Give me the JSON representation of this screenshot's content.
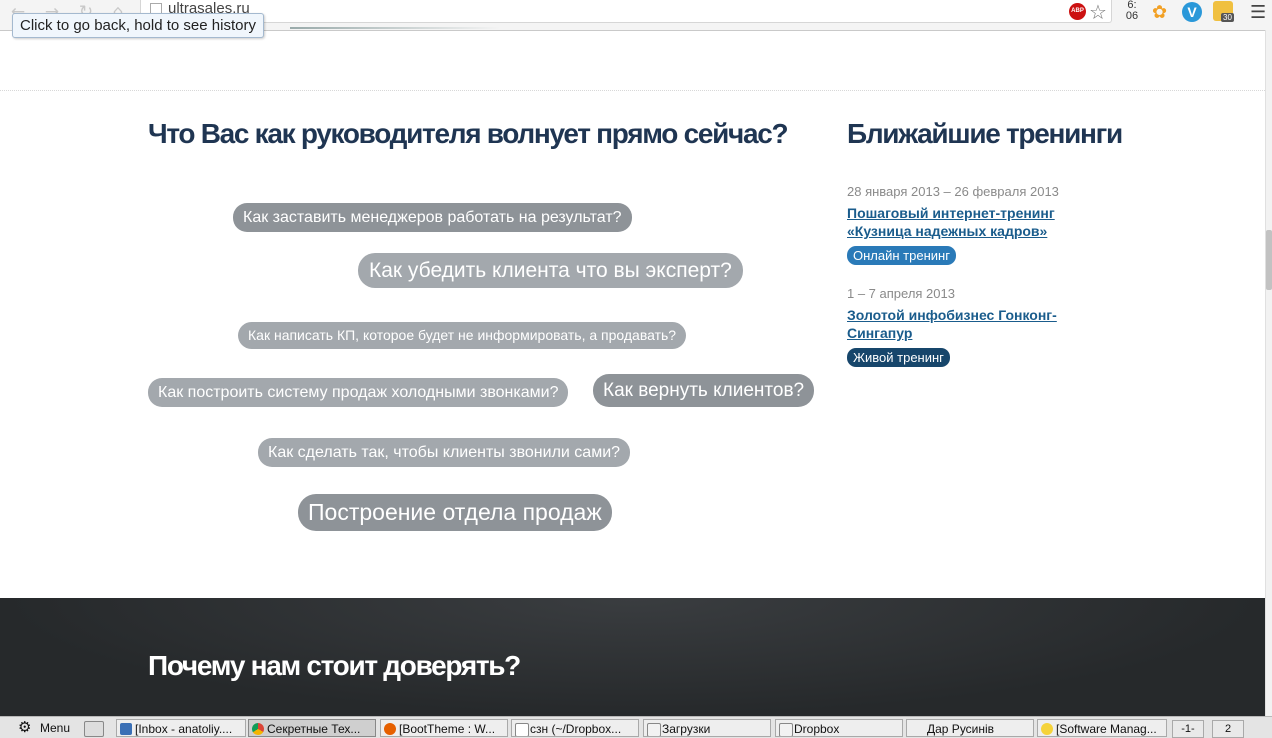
{
  "browser": {
    "url": "ultrasales.ru",
    "tooltip": "Click to go back, hold to see history",
    "clock": [
      "6:",
      "06"
    ],
    "extension_badge": "30",
    "abp_label": "ABP",
    "v_label": "V"
  },
  "main": {
    "heading": "Что Вас как руководителя волнует прямо сейчас?",
    "topics": [
      "Как заставить менеджеров работать на результат?",
      "Как убедить клиента что вы эксперт?",
      "Как написать КП, которое будет не информировать, а продавать?",
      "Как построить систему продаж холодными звонками?",
      "Как вернуть клиентов?",
      "Как сделать так, чтобы клиенты звонили сами?",
      "Построение отдела продаж"
    ]
  },
  "sidebar": {
    "heading": "Ближайшие тренинги",
    "trainings": [
      {
        "date": "28 января 2013 – 26 февраля 2013",
        "title": "Пошаговый интернет-тренинг «Кузница надежных кадров»",
        "badge": "Онлайн тренинг",
        "badge_color": "#2a7ab8"
      },
      {
        "date": "1 – 7 апреля 2013",
        "title": "Золотой инфобизнес Гонконг-Сингапур",
        "badge": "Живой тренинг",
        "badge_color": "#17466b"
      }
    ]
  },
  "trust": {
    "heading": "Почему нам стоит доверять?"
  },
  "taskbar": {
    "menu_label": "Menu",
    "tasks": [
      "[Inbox - anatoliy....",
      "Секретные Тех...",
      "[BootTheme : W...",
      "сзн (~/Dropbox...",
      "Загрузки",
      "Dropbox",
      "Дар Русинів",
      "[Software Manag..."
    ],
    "workspaces": [
      "-1-",
      "2"
    ]
  },
  "colors": {
    "heading": "#1f3552",
    "link": "#1a5c8c",
    "tag_bg": "#a3a8ad",
    "dark_bg": "#26292b"
  }
}
